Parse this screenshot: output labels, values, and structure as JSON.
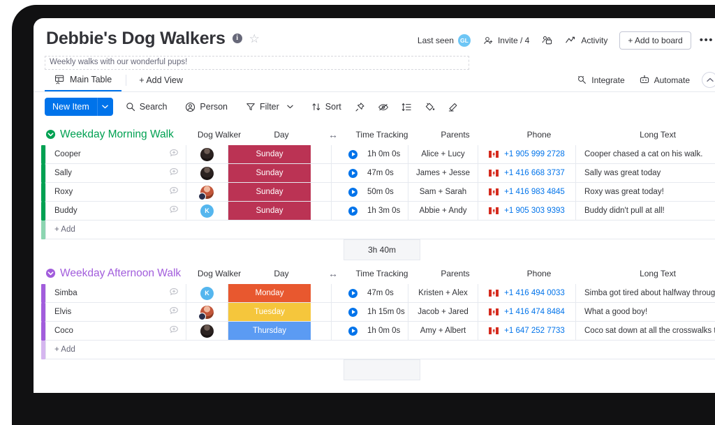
{
  "board": {
    "title": "Debbie's Dog Walkers",
    "info_icon": "info-icon",
    "star_icon": "star-icon",
    "subtitle": "Weekly walks with our wonderful pups!"
  },
  "header_actions": {
    "last_seen_label": "Last seen",
    "last_seen_avatar": "GL",
    "invite_label": "Invite / 4",
    "permissions_icon": "lock-person-icon",
    "activity_label": "Activity",
    "add_to_board_label": "+ Add to board",
    "more_label": "•••"
  },
  "viewbar": {
    "tabs": [
      {
        "label": "Main Table",
        "icon": "table-home-icon",
        "active": true
      }
    ],
    "add_view_label": "+ Add View",
    "integrate_label": "Integrate",
    "automate_label": "Automate",
    "collapse_icon": "chevron-up-icon"
  },
  "toolbar": {
    "new_item_label": "New Item",
    "new_item_caret": "chevron-down-icon",
    "search_label": "Search",
    "person_label": "Person",
    "filter_label": "Filter",
    "filter_caret": "chevron-down-icon",
    "sort_label": "Sort",
    "icons": [
      "pin-icon",
      "eye-off-icon",
      "row-height-icon",
      "paint-bucket-icon",
      "pen-icon"
    ]
  },
  "columns": [
    {
      "key": "name",
      "label": ""
    },
    {
      "key": "walker",
      "label": "Dog Walker"
    },
    {
      "key": "day",
      "label": "Day"
    },
    {
      "key": "arrows",
      "label": "↔"
    },
    {
      "key": "time",
      "label": "Time Tracking"
    },
    {
      "key": "parents",
      "label": "Parents"
    },
    {
      "key": "phone",
      "label": "Phone"
    },
    {
      "key": "long",
      "label": "Long Text"
    }
  ],
  "colors": {
    "accent_blue": "#0073ea",
    "group_green": "#00a152",
    "group_purple": "#a25ddc",
    "day_sunday": "#bb3354",
    "day_monday": "#e8582f",
    "day_tuesday": "#f5c63c",
    "day_thursday": "#5b9bf3",
    "phone_link": "#0073ea",
    "avatar_k": "#55b6ee"
  },
  "groups": [
    {
      "name": "Weekday Morning Walk",
      "color": "#00a152",
      "collapse_icon": "collapse-circle-icon",
      "rows": [
        {
          "name": "Cooper",
          "walker": {
            "type": "photo",
            "tone": "dark",
            "badge": false,
            "initial": ""
          },
          "day": "Sunday",
          "day_color": "#bb3354",
          "time": "1h 0m 0s",
          "parents": "Alice + Lucy",
          "phone": "+1 905 999 2728",
          "long": "Cooper chased a cat on his walk."
        },
        {
          "name": "Sally",
          "walker": {
            "type": "photo",
            "tone": "dark",
            "badge": false,
            "initial": ""
          },
          "day": "Sunday",
          "day_color": "#bb3354",
          "time": "47m 0s",
          "parents": "James + Jesse",
          "phone": "+1 416 668 3737",
          "long": "Sally was great today"
        },
        {
          "name": "Roxy",
          "walker": {
            "type": "photo",
            "tone": "warm",
            "badge": true,
            "initial": ""
          },
          "day": "Sunday",
          "day_color": "#bb3354",
          "time": "50m 0s",
          "parents": "Sam + Sarah",
          "phone": "+1 416 983 4845",
          "long": "Roxy was great today!"
        },
        {
          "name": "Buddy",
          "walker": {
            "type": "initial",
            "tone": "",
            "badge": false,
            "initial": "K"
          },
          "day": "Sunday",
          "day_color": "#bb3354",
          "time": "1h 3m 0s",
          "parents": "Abbie + Andy",
          "phone": "+1 905 303 9393",
          "long": "Buddy didn't pull at all!"
        }
      ],
      "add_label": "+ Add",
      "summary": "3h 40m"
    },
    {
      "name": "Weekday Afternoon Walk",
      "color": "#a25ddc",
      "collapse_icon": "collapse-circle-icon",
      "rows": [
        {
          "name": "Simba",
          "walker": {
            "type": "initial",
            "tone": "",
            "badge": false,
            "initial": "K"
          },
          "day": "Monday",
          "day_color": "#e8582f",
          "time": "47m 0s",
          "parents": "Kristen + Alex",
          "phone": "+1 416 494 0033",
          "long": "Simba got tired about halfway through today."
        },
        {
          "name": "Elvis",
          "walker": {
            "type": "photo",
            "tone": "warm",
            "badge": true,
            "initial": ""
          },
          "day": "Tuesday",
          "day_color": "#f5c63c",
          "time": "1h 15m 0s",
          "parents": "Jacob + Jared",
          "phone": "+1 416 474 8484",
          "long": "What a good boy!"
        },
        {
          "name": "Coco",
          "walker": {
            "type": "photo",
            "tone": "dark",
            "badge": false,
            "initial": ""
          },
          "day": "Thursday",
          "day_color": "#5b9bf3",
          "time": "1h 0m 0s",
          "parents": "Amy + Albert",
          "phone": "+1 647 252 7733",
          "long": "Coco sat down at all the crosswalks today!"
        }
      ],
      "add_label": "+ Add",
      "summary": ""
    }
  ]
}
